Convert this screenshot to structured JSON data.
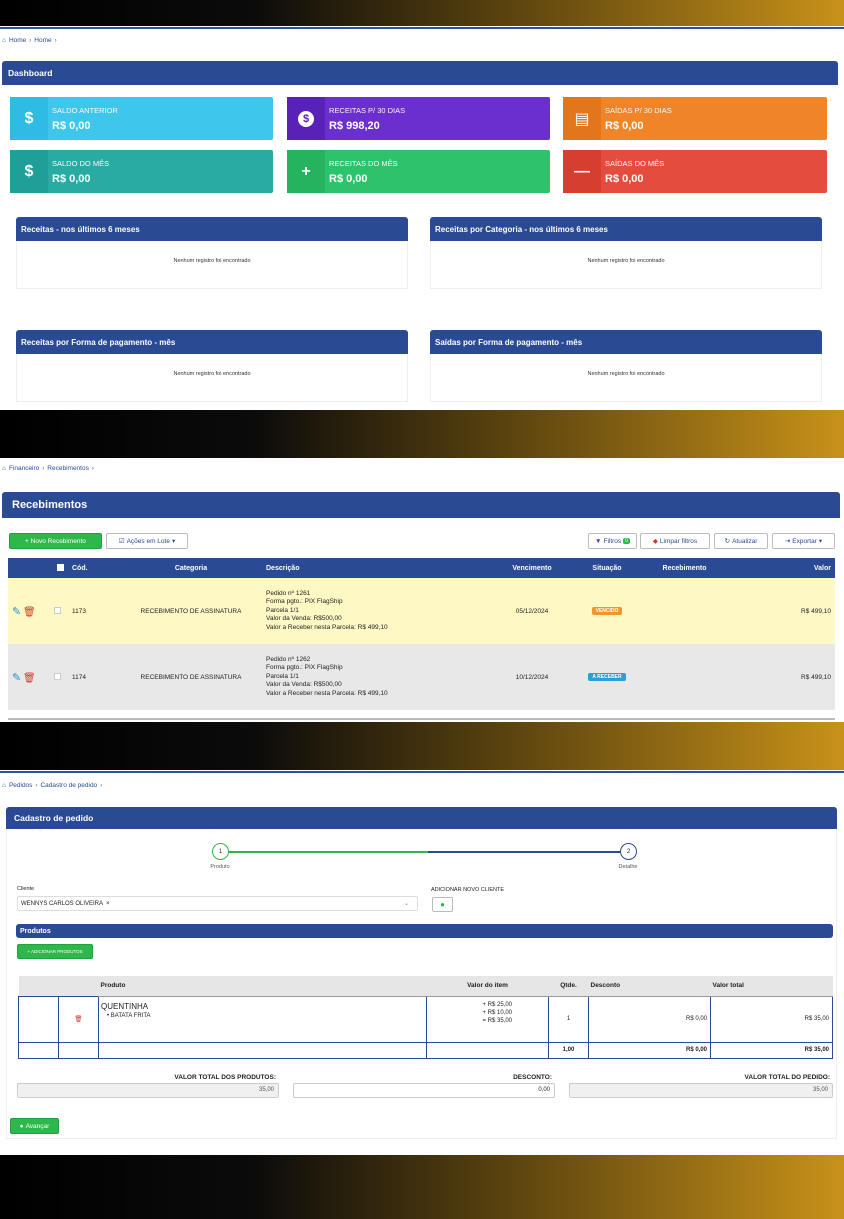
{
  "section1": {
    "breadcrumb": [
      "Home",
      "Home"
    ],
    "panel_title": "Dashboard",
    "cards": [
      {
        "icon": "dollar-icon",
        "label": "SALDO ANTERIOR",
        "value": "R$ 0,00",
        "color": "#3ec6ec",
        "icon_bg": "#2fbbe3"
      },
      {
        "icon": "money-bag-icon",
        "label": "RECEITAS P/ 30 DIAS",
        "value": "R$ 998,20",
        "color": "#6b2fd0",
        "icon_bg": "#5822b8"
      },
      {
        "icon": "receipt-icon",
        "label": "SAÍDAS P/ 30 DIAS",
        "value": "R$ 0,00",
        "color": "#ef8428",
        "icon_bg": "#e2761d"
      },
      {
        "icon": "dollar-icon",
        "label": "SALDO DO MÊS",
        "value": "R$ 0,00",
        "color": "#29aba4",
        "icon_bg": "#1f9f98"
      },
      {
        "icon": "plus-icon",
        "label": "RECEITAS DO MÊS",
        "value": "R$ 0,00",
        "color": "#2dc26c",
        "icon_bg": "#25b35f"
      },
      {
        "icon": "minus-icon",
        "label": "SAÍDAS DO MÊS",
        "value": "R$ 0,00",
        "color": "#e44d3d",
        "icon_bg": "#d53f30"
      }
    ],
    "widgets": [
      {
        "title": "Receitas - nos últimos 6 meses",
        "empty": "Nenhum registro foi encontrado"
      },
      {
        "title": "Receitas por Categoria - nos últimos 6 meses",
        "empty": "Nenhum registro foi encontrado"
      },
      {
        "title": "Receitas por Forma de pagamento - mês",
        "empty": "Nenhum registro foi encontrado"
      },
      {
        "title": "Saídas por Forma de pagamento - mês",
        "empty": "Nenhum registro foi encontrado"
      }
    ]
  },
  "section2": {
    "breadcrumb": [
      "Financeiro",
      "Recebimentos"
    ],
    "panel_title": "Recebimentos",
    "toolbar": {
      "new": "+ Novo Recebimento",
      "batch": "Ações em Lote",
      "filters": "Filtros",
      "filters_count": "0",
      "clear": "Limpar filtros",
      "refresh": "Atualizar",
      "export": "Exportar"
    },
    "columns": [
      "Cód.",
      "Categoria",
      "Descrição",
      "Vencimento",
      "Situação",
      "Recebimento",
      "Valor"
    ],
    "rows": [
      {
        "code": "1173",
        "category": "RECEBIMENTO DE ASSINATURA",
        "desc": [
          "Pedido nº 1261",
          "Forma pgto.: PIX FlagShip",
          "Parcela 1/1",
          "Valor da Venda: R$500,00",
          "Valor a Receber nesta Parcela: R$ 499,10"
        ],
        "due": "05/12/2024",
        "status": "VENCIDO",
        "status_color": "#f0962a",
        "received": "",
        "value": "R$ 499,10",
        "bg": "#fdf8c4"
      },
      {
        "code": "1174",
        "category": "RECEBIMENTO DE ASSINATURA",
        "desc": [
          "Pedido nº 1262",
          "Forma pgto.: PIX FlagShip",
          "Parcela 1/1",
          "Valor da Venda: R$500,00",
          "Valor a Receber nesta Parcela: R$ 499,10"
        ],
        "due": "10/12/2024",
        "status": "A RECEBER",
        "status_color": "#2a9fd8",
        "received": "",
        "value": "R$ 499,10",
        "bg": "#e8e8e8"
      }
    ]
  },
  "section3": {
    "breadcrumb": [
      "Pedidos",
      "Cadastro de pedido"
    ],
    "panel_title": "Cadastro de pedido",
    "steps": [
      {
        "num": "1",
        "label": "Produto"
      },
      {
        "num": "2",
        "label": "Detalhe"
      }
    ],
    "client_label": "Cliente",
    "client_value": "WENNYS CARLOS OLIVEIRA",
    "add_client_label": "ADICIONAR NOVO CLIENTE",
    "products_title": "Produtos",
    "add_products": "+ ADICIONAR PRODUTOS",
    "columns": [
      "Produto",
      "Valor do item",
      "Qtde.",
      "Desconto",
      "Valor total"
    ],
    "item": {
      "name": "QUENTINHA",
      "sub": "BATATA FRITA",
      "prices": [
        "+ R$ 25,00",
        "+ R$ 10,00",
        "= R$ 35,00"
      ],
      "qty": "1",
      "discount": "R$ 0,00",
      "total": "R$ 35,00"
    },
    "totals_row": {
      "qty": "1,00",
      "discount": "R$ 0,00",
      "total": "R$ 35,00"
    },
    "summary": {
      "products_label": "VALOR TOTAL DOS PRODUTOS:",
      "products_value": "35,00",
      "discount_label": "DESCONTO:",
      "discount_value": "0,00",
      "order_label": "VALOR TOTAL DO PEDIDO:",
      "order_value": "35,00"
    },
    "next": "Avançar"
  }
}
